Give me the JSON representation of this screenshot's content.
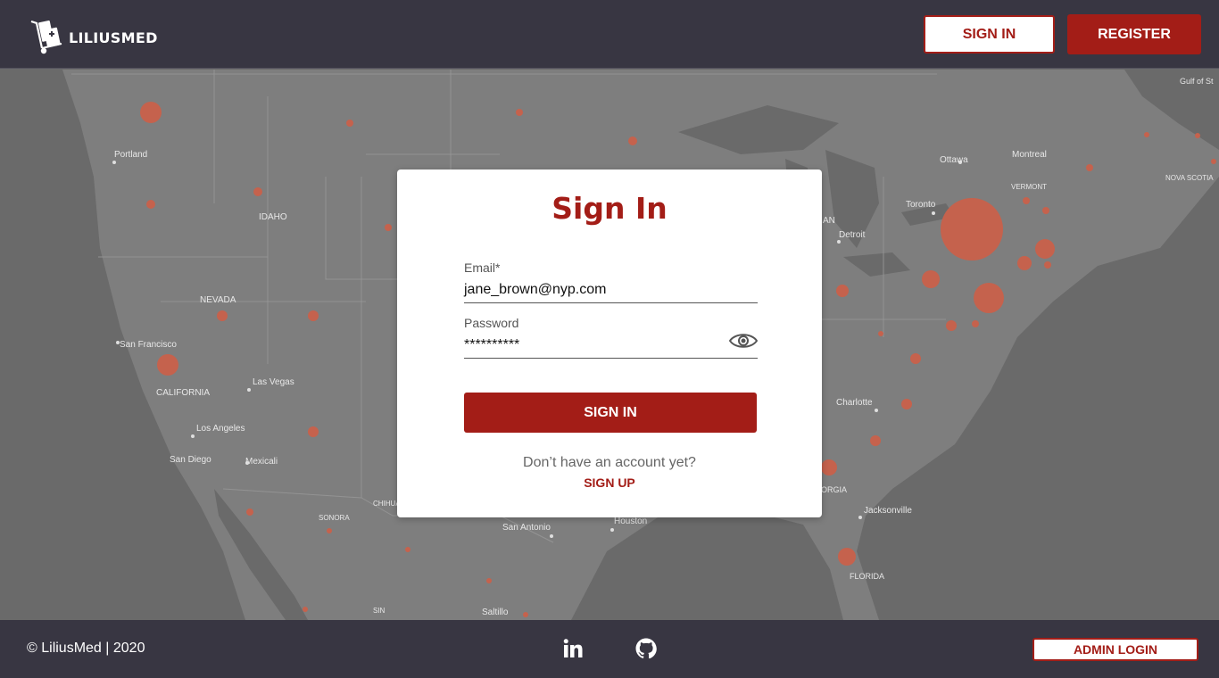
{
  "header": {
    "brand": "LILIUSMED",
    "signin_label": "SIGN IN",
    "register_label": "REGISTER"
  },
  "map": {
    "labels": [
      "Portland",
      "IDAHO",
      "NEVADA",
      "San Francisco",
      "CALIFORNIA",
      "Las Vegas",
      "Los Angeles",
      "San Diego",
      "Mexicali",
      "SONORA",
      "CHIHUA",
      "SIN",
      "Saltillo",
      "San Antonio",
      "Houston",
      "Ottawa",
      "Montreal",
      "VERMONT",
      "NOVA SCOTIA",
      "Gulf of St",
      "Toronto",
      "Detroit",
      "AN",
      "Charlotte",
      "ORGIA",
      "Jacksonville",
      "FLORIDA"
    ]
  },
  "signin_card": {
    "title": "Sign In",
    "email_label": "Email*",
    "email_value": "jane_brown@nyp.com",
    "password_label": "Password",
    "password_value": "**********",
    "submit_label": "SIGN IN",
    "no_account_text": "Don’t have an account yet?",
    "signup_label": "SIGN UP"
  },
  "footer": {
    "copyright": "©  LiliusMed | 2020",
    "admin_label": "ADMIN LOGIN"
  },
  "colors": {
    "brand_red": "#a31d17",
    "dark_bar": "#383642",
    "map_dot": "#c0553e"
  }
}
